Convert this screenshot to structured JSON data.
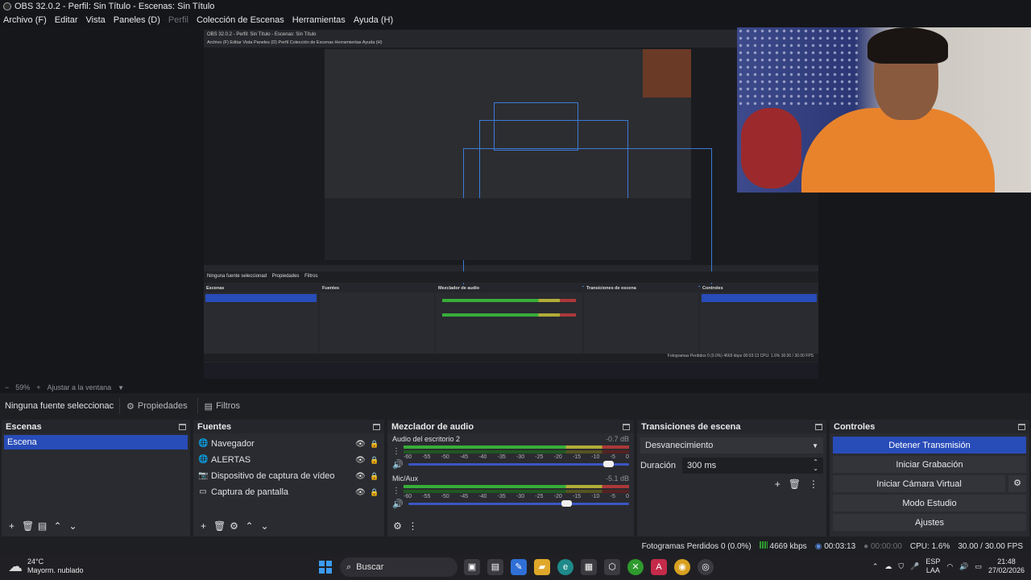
{
  "window": {
    "title": "OBS 32.0.2 - Perfil: Sin Título - Escenas: Sin Título"
  },
  "menu": [
    "Archivo (F)",
    "Editar",
    "Vista",
    "Paneles (D)",
    "Perfil",
    "Colección de Escenas",
    "Herramientas",
    "Ayuda (H)"
  ],
  "nested": {
    "title": "OBS 32.0.2 - Perfil: Sin Título - Escenas: Sin Título",
    "menu": "Archivo (F)   Editar   Vista   Paneles (D)   Perfil   Colección de Escenas   Herramientas   Ayuda (H)",
    "zoom": "59%   Ajustar a la ventana",
    "no_source": "Ninguna fuente seleccionad",
    "properties": "Propiedades",
    "filters": "Filtros",
    "docks": [
      "Escenas",
      "Fuentes",
      "Mezclador de audio",
      "Transiciones de escena",
      "Controles"
    ],
    "status": "Fotogramas Perdidos 0 (0.0%)   4669 kbps   00:03:13   CPU: 1.6%   30.00 / 30.00 FPS"
  },
  "zoom": {
    "minus": "−",
    "value": "59%",
    "plus": "+",
    "fit": "Ajustar a la ventana"
  },
  "source_toolbar": {
    "none_selected": "Ninguna fuente seleccionac",
    "properties": "Propiedades",
    "filters": "Filtros"
  },
  "scenes": {
    "title": "Escenas",
    "items": [
      "Escena"
    ]
  },
  "sources": {
    "title": "Fuentes",
    "items": [
      {
        "name": "Navegador",
        "icon": "globe-icon"
      },
      {
        "name": "ALERTAS",
        "icon": "globe-icon"
      },
      {
        "name": "Dispositivo de captura de vídeo",
        "icon": "camera-icon"
      },
      {
        "name": "Captura de pantalla",
        "icon": "monitor-icon"
      }
    ]
  },
  "mixer": {
    "title": "Mezclador de audio",
    "channels": [
      {
        "name": "Audio del escritorio 2",
        "db": "-0.7 dB",
        "volume": 0.93
      },
      {
        "name": "Mic/Aux",
        "db": "-5.1 dB",
        "volume": 0.74
      }
    ],
    "ticks": [
      "-60",
      "-55",
      "-50",
      "-45",
      "-40",
      "-35",
      "-30",
      "-25",
      "-20",
      "-15",
      "-10",
      "-5",
      "0"
    ]
  },
  "transitions": {
    "title": "Transiciones de escena",
    "selected": "Desvanecimiento",
    "duration_label": "Duración",
    "duration": "300 ms"
  },
  "controls": {
    "title": "Controles",
    "buttons": [
      "Detener Transmisión",
      "Iniciar Grabación",
      "Iniciar Cámara Virtual",
      "Modo Estudio",
      "Ajustes"
    ]
  },
  "status": {
    "dropped": "Fotogramas Perdidos 0 (0.0%)",
    "kbps": "4669 kbps",
    "stream_time": "00:03:13",
    "rec_time": "00:00:00",
    "cpu": "CPU: 1.6%",
    "fps": "30.00 / 30.00 FPS"
  },
  "taskbar": {
    "weather_temp": "24°C",
    "weather_desc": "Mayorm. nublado",
    "search": "Buscar",
    "lang_top": "ESP",
    "lang_bottom": "LAA",
    "time": "21:48",
    "date": "27/02/2026"
  },
  "colors": {
    "accent": "#284cb8",
    "background": "#1e1f22",
    "dock": "#2a2b30"
  }
}
